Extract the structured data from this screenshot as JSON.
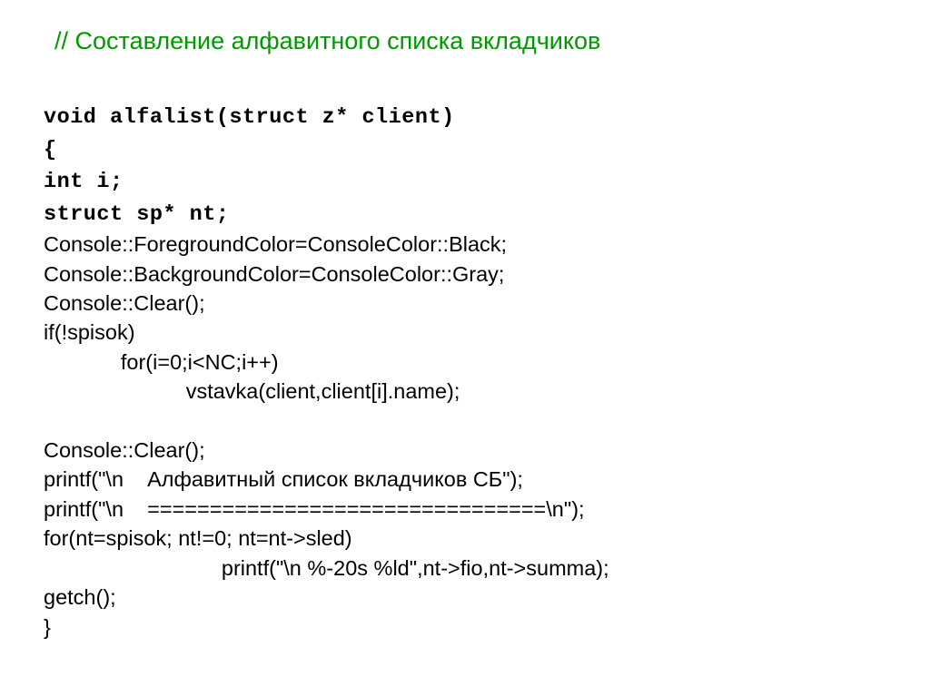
{
  "title": "// Составление алфавитного списка вкладчиков",
  "lines": {
    "l1": "void alfalist(struct z* client)",
    "l2": "{",
    "l3": "int i;",
    "l4": "struct sp* nt;",
    "l5": "Console::ForegroundColor=ConsoleColor::Black;",
    "l6": "Console::BackgroundColor=ConsoleColor::Gray;",
    "l7": "Console::Clear();",
    "l8": "if(!spisok)",
    "l9": "             for(i=0;i<NC;i++)",
    "l10": "                        vstavka(client,client[i].name);",
    "l11": "",
    "l12": "Console::Clear();",
    "l13": "printf(\"\\n    Алфавитный список вкладчиков СБ\");",
    "l14": "printf(\"\\n    ================================\\n\");",
    "l15": "for(nt=spisok; nt!=0; nt=nt->sled)",
    "l16": "                              printf(\"\\n %-20s %ld\",nt->fio,nt->summa);",
    "l17": "getch();",
    "l18": "}"
  }
}
